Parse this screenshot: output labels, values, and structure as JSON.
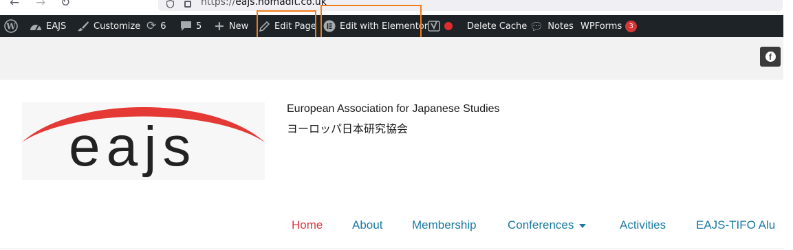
{
  "browser": {
    "url_prefix": "https://",
    "url_host": "eajs.nomadit.co.uk",
    "back_icon": "arrow-left-icon",
    "forward_icon": "arrow-right-icon",
    "reload_icon": "reload-icon"
  },
  "adminbar": {
    "site_name": "EAJS",
    "customize": "Customize",
    "updates_count": "6",
    "comments_count": "5",
    "new": "New",
    "edit_page": "Edit Page",
    "edit_elementor": "Edit with Elementor",
    "delete_cache": "Delete Cache",
    "notes": "Notes",
    "wpforms": "WPForms",
    "wpforms_count": "3"
  },
  "header": {
    "logo_text": "eajs",
    "title": "European Association for Japanese Studies",
    "subtitle": "ヨーロッパ日本研究協会",
    "social_icon": "facebook-icon"
  },
  "nav": {
    "items": [
      "Home",
      "About",
      "Membership",
      "Conferences",
      "Activities",
      "EAJS-TIFO Alu"
    ],
    "active_index": 0
  },
  "colors": {
    "adminbar_bg": "#1d2327",
    "highlight": "#f07d1a",
    "nav_link": "#1b7aa3",
    "nav_active": "#d9363e",
    "logo_arc": "#e53935"
  }
}
